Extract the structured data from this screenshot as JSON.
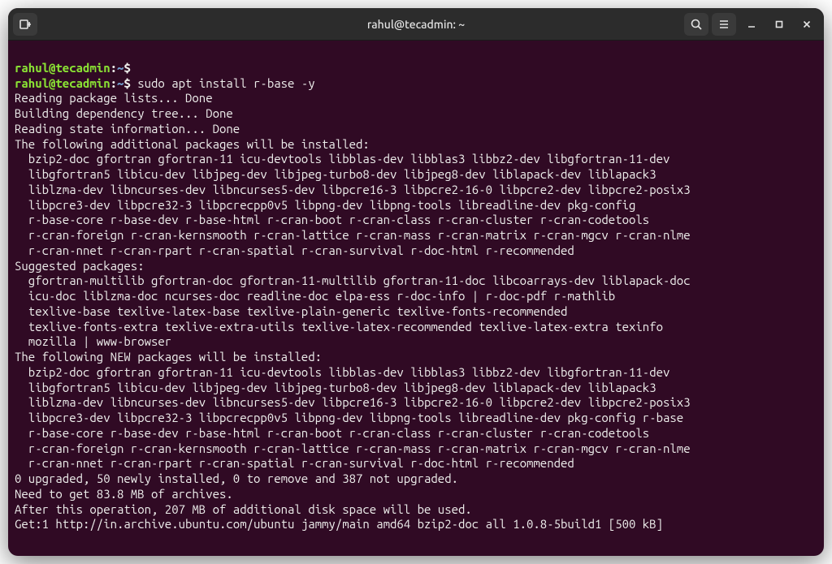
{
  "window": {
    "title": "rahul@tecadmin: ~"
  },
  "prompt": {
    "user_host": "rahul@tecadmin",
    "colon": ":",
    "path": "~",
    "dollar": "$"
  },
  "commands": {
    "blank": " ",
    "cmd1": "sudo apt install r-base -y"
  },
  "output": {
    "l1": "Reading package lists... Done",
    "l2": "Building dependency tree... Done",
    "l3": "Reading state information... Done",
    "l4": "The following additional packages will be installed:",
    "l5": "  bzip2-doc gfortran gfortran-11 icu-devtools libblas-dev libblas3 libbz2-dev libgfortran-11-dev",
    "l6": "  libgfortran5 libicu-dev libjpeg-dev libjpeg-turbo8-dev libjpeg8-dev liblapack-dev liblapack3",
    "l7": "  liblzma-dev libncurses-dev libncurses5-dev libpcre16-3 libpcre2-16-0 libpcre2-dev libpcre2-posix3",
    "l8": "  libpcre3-dev libpcre32-3 libpcrecpp0v5 libpng-dev libpng-tools libreadline-dev pkg-config",
    "l9": "  r-base-core r-base-dev r-base-html r-cran-boot r-cran-class r-cran-cluster r-cran-codetools",
    "l10": "  r-cran-foreign r-cran-kernsmooth r-cran-lattice r-cran-mass r-cran-matrix r-cran-mgcv r-cran-nlme",
    "l11": "  r-cran-nnet r-cran-rpart r-cran-spatial r-cran-survival r-doc-html r-recommended",
    "l12": "Suggested packages:",
    "l13": "  gfortran-multilib gfortran-doc gfortran-11-multilib gfortran-11-doc libcoarrays-dev liblapack-doc",
    "l14": "  icu-doc liblzma-doc ncurses-doc readline-doc elpa-ess r-doc-info | r-doc-pdf r-mathlib",
    "l15": "  texlive-base texlive-latex-base texlive-plain-generic texlive-fonts-recommended",
    "l16": "  texlive-fonts-extra texlive-extra-utils texlive-latex-recommended texlive-latex-extra texinfo",
    "l17": "  mozilla | www-browser",
    "l18": "The following NEW packages will be installed:",
    "l19": "  bzip2-doc gfortran gfortran-11 icu-devtools libblas-dev libblas3 libbz2-dev libgfortran-11-dev",
    "l20": "  libgfortran5 libicu-dev libjpeg-dev libjpeg-turbo8-dev libjpeg8-dev liblapack-dev liblapack3",
    "l21": "  liblzma-dev libncurses-dev libncurses5-dev libpcre16-3 libpcre2-16-0 libpcre2-dev libpcre2-posix3",
    "l22": "  libpcre3-dev libpcre32-3 libpcrecpp0v5 libpng-dev libpng-tools libreadline-dev pkg-config r-base",
    "l23": "  r-base-core r-base-dev r-base-html r-cran-boot r-cran-class r-cran-cluster r-cran-codetools",
    "l24": "  r-cran-foreign r-cran-kernsmooth r-cran-lattice r-cran-mass r-cran-matrix r-cran-mgcv r-cran-nlme",
    "l25": "  r-cran-nnet r-cran-rpart r-cran-spatial r-cran-survival r-doc-html r-recommended",
    "l26": "0 upgraded, 50 newly installed, 0 to remove and 387 not upgraded.",
    "l27": "Need to get 83.8 MB of archives.",
    "l28": "After this operation, 207 MB of additional disk space will be used.",
    "l29": "Get:1 http://in.archive.ubuntu.com/ubuntu jammy/main amd64 bzip2-doc all 1.0.8-5build1 [500 kB]"
  }
}
